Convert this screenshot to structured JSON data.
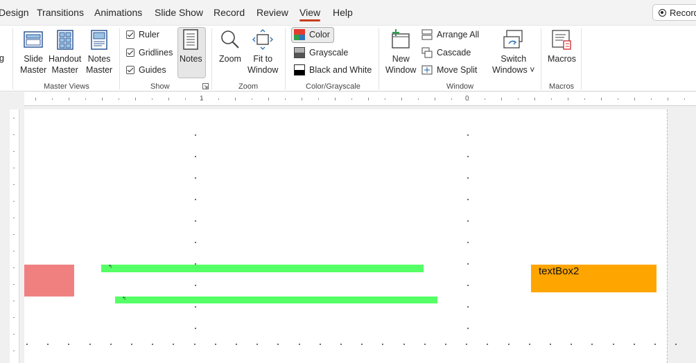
{
  "menu": {
    "tabs": [
      "Design",
      "Transitions",
      "Animations",
      "Slide Show",
      "Record",
      "Review",
      "View",
      "Help"
    ],
    "active": "View",
    "record_button": "Record"
  },
  "ribbon": {
    "partial_label": "g",
    "master_views": {
      "group_label": "Master Views",
      "slide_master": [
        "Slide",
        "Master"
      ],
      "handout_master": [
        "Handout",
        "Master"
      ],
      "notes_master": [
        "Notes",
        "Master"
      ]
    },
    "show": {
      "group_label": "Show",
      "ruler": "Ruler",
      "gridlines": "Gridlines",
      "guides": "Guides",
      "ruler_checked": true,
      "gridlines_checked": true,
      "guides_checked": true,
      "notes": "Notes"
    },
    "zoom": {
      "group_label": "Zoom",
      "zoom": "Zoom",
      "fit_to_window": [
        "Fit to",
        "Window"
      ]
    },
    "color_grayscale": {
      "group_label": "Color/Grayscale",
      "color": "Color",
      "grayscale": "Grayscale",
      "black_and_white": "Black and White"
    },
    "window": {
      "group_label": "Window",
      "new_window": [
        "New",
        "Window"
      ],
      "arrange_all": "Arrange All",
      "cascade": "Cascade",
      "move_split": "Move Split",
      "switch_windows": [
        "Switch",
        "Windows ˅"
      ]
    },
    "macros": {
      "group_label": "Macros",
      "macros": "Macros"
    }
  },
  "ruler": {
    "labels": [
      "1",
      "0"
    ]
  },
  "slide": {
    "textbox2": "textBox2",
    "green_mark_1": "↰",
    "green_mark_2": "↰"
  },
  "colors": {
    "accent_underline": "#c43e1c",
    "pink_shape": "#f08080",
    "green_shape": "#55ff66",
    "orange_textbox": "#ffa500"
  }
}
